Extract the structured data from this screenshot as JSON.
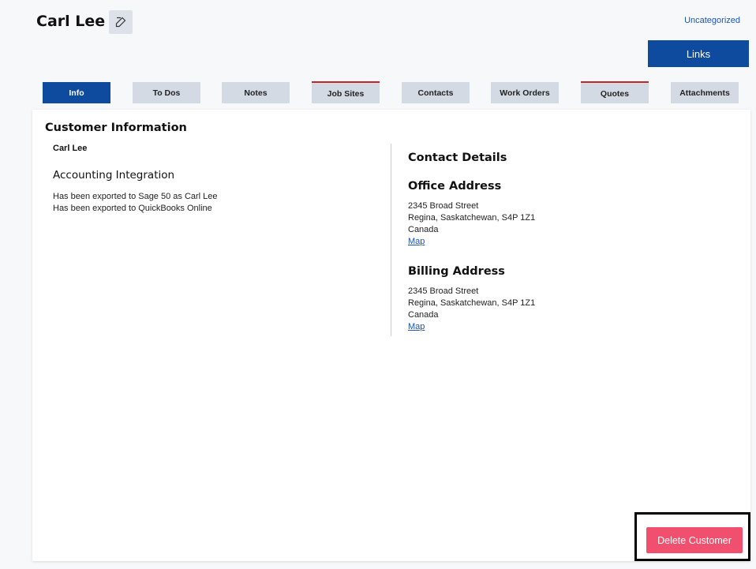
{
  "header": {
    "customer_name": "Carl Lee",
    "edit_icon": "edit-pencil-icon",
    "category_link": "Uncategorized",
    "links_button": "Links"
  },
  "tabs": [
    {
      "label": "Info",
      "active": true,
      "alert": false
    },
    {
      "label": "To Dos",
      "active": false,
      "alert": false
    },
    {
      "label": "Notes",
      "active": false,
      "alert": false
    },
    {
      "label": "Job Sites",
      "active": false,
      "alert": true
    },
    {
      "label": "Contacts",
      "active": false,
      "alert": false
    },
    {
      "label": "Work Orders",
      "active": false,
      "alert": false
    },
    {
      "label": "Quotes",
      "active": false,
      "alert": true
    },
    {
      "label": "Attachments",
      "active": false,
      "alert": false
    }
  ],
  "customer_info": {
    "title": "Customer Information",
    "name": "Carl Lee",
    "accounting": {
      "title": "Accounting Integration",
      "lines": [
        "Has been exported to Sage 50 as Carl Lee",
        "Has been exported to QuickBooks Online"
      ]
    }
  },
  "contact_details": {
    "title": "Contact Details",
    "office": {
      "title": "Office Address",
      "street": "2345 Broad Street",
      "city": "Regina, Saskatchewan, S4P 1Z1",
      "country": "Canada",
      "map_link": "Map"
    },
    "billing": {
      "title": "Billing Address",
      "street": "2345 Broad Street",
      "city": "Regina, Saskatchewan, S4P 1Z1",
      "country": "Canada",
      "map_link": "Map"
    }
  },
  "actions": {
    "delete_button": "Delete Customer"
  },
  "colors": {
    "primary": "#0e4a9e",
    "tab_inactive": "#d4dae3",
    "tab_alert_border": "#c0272d",
    "danger": "#f0506e",
    "link": "#1a55b0"
  }
}
